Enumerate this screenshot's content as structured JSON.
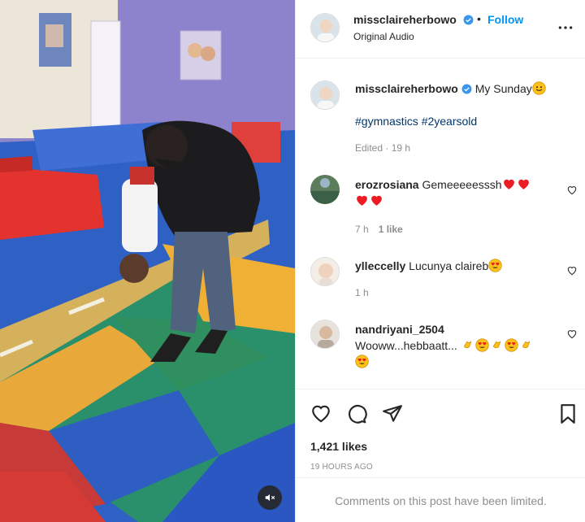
{
  "post": {
    "username": "missclaireherbowo",
    "follow_label": "Follow",
    "dot": "•",
    "audio": "Original Audio"
  },
  "caption": {
    "username": "missclaireherbowo",
    "text": "My Sunday",
    "emoji_icon": "grinning-face-icon",
    "hashtags": "#gymnastics #2yearsold",
    "meta": "Edited · 19 h"
  },
  "comments": [
    {
      "username": "erozrosiana",
      "text": "Gemeeeeesssh",
      "emojis": [
        "red-heart-icon",
        "red-heart-icon",
        "red-heart-icon",
        "red-heart-icon"
      ],
      "time": "7 h",
      "likes": "1 like"
    },
    {
      "username": "ylleccelly",
      "text": "Lucunya claireb",
      "emojis": [
        "heart-eyes-face-icon"
      ],
      "time": "1 h"
    },
    {
      "username": "nandriyani_2504",
      "text": "Wooww...hebbaatt...",
      "emojis": [
        "clapping-hands-icon",
        "heart-eyes-face-icon",
        "clapping-hands-icon",
        "heart-eyes-face-icon",
        "clapping-hands-icon",
        "heart-eyes-face-icon"
      ]
    }
  ],
  "actions": {
    "likes": "1,421 likes",
    "time": "19 HOURS AGO",
    "limited_notice": "Comments on this post have been limited."
  },
  "colors": {
    "accent": "#0095f6",
    "verified": "#3897f0",
    "muted": "#8e8e8e",
    "hashtag": "#00376b",
    "heart": "#ed1c24"
  }
}
